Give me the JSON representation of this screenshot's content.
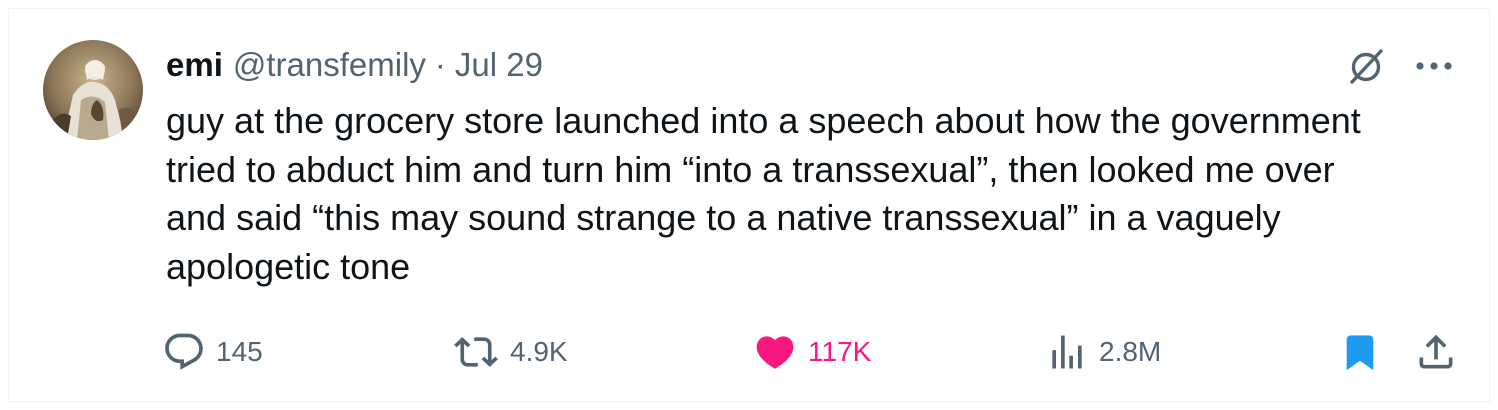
{
  "tweet": {
    "author": {
      "display_name": "emi",
      "handle": "@transfemily",
      "separator": "·",
      "date": "Jul 29"
    },
    "text_lines": [
      "guy at the grocery store launched into a speech about how the government",
      "tried to abduct him and turn him “into a transsexual”, then looked me over",
      "and said “this may sound strange to a native transsexual” in a vaguely",
      "apologetic tone"
    ],
    "actions": {
      "replies": "145",
      "reposts": "4.9K",
      "likes": "117K",
      "views": "2.8M"
    },
    "state": {
      "liked": true,
      "bookmarked": true
    },
    "icons": {
      "header": [
        "grok-icon",
        "more-icon"
      ],
      "actions": [
        "reply-icon",
        "repost-icon",
        "like-icon",
        "views-icon",
        "bookmark-icon",
        "share-icon"
      ]
    },
    "colors": {
      "text": "#0f1419",
      "secondary": "#536471",
      "like": "#f91880",
      "bookmark": "#1d9bf0",
      "border": "#eff3f4"
    }
  }
}
